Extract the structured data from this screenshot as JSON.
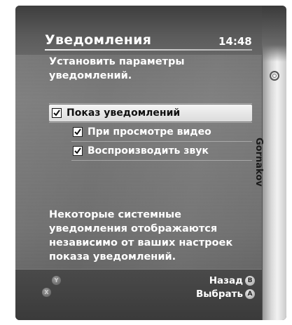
{
  "header": {
    "title": "Уведомления",
    "time": "14:48"
  },
  "subtitle": "Установить параметры уведомлений.",
  "options": [
    {
      "label": "Показ уведомлений",
      "checked": true,
      "selected": true,
      "level": 0
    },
    {
      "label": "При просмотре видео",
      "checked": true,
      "selected": false,
      "level": 1
    },
    {
      "label": "Воспроизводить звук",
      "checked": true,
      "selected": false,
      "level": 1
    }
  ],
  "note": "Некоторые системные уведомления отображаются независимо от ваших настроек показа уведомлений.",
  "footer": {
    "ghost_buttons": [
      "Y",
      "X"
    ],
    "back_label": "Назад",
    "back_button": "B",
    "select_label": "Выбрать",
    "select_button": "A"
  },
  "blade": {
    "gamertag": "Gornakov",
    "icon": "xbox-ring-icon"
  },
  "colors": {
    "panel": "#6f6f6f",
    "text": "#ffffff",
    "selection": "#e8e8e8"
  }
}
